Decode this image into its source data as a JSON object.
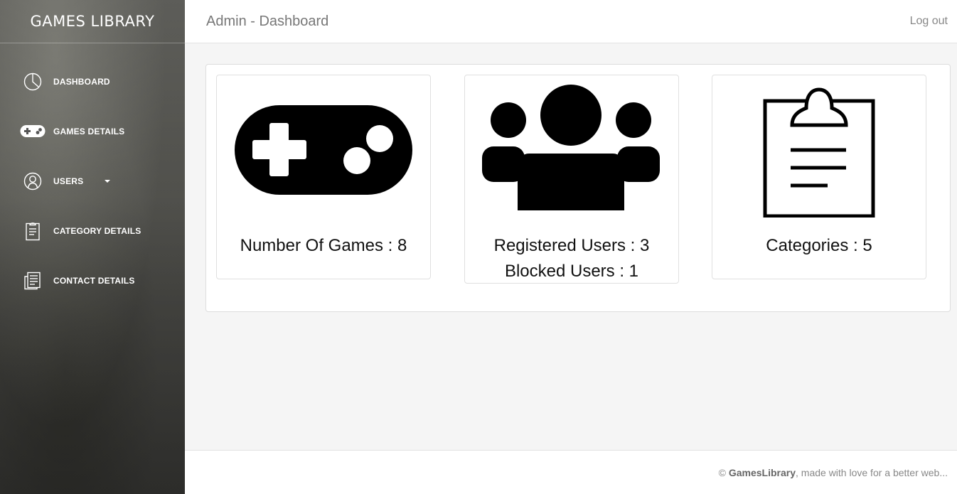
{
  "sidebar": {
    "brand": "GAMES LIBRARY",
    "items": [
      {
        "label": "DASHBOARD",
        "icon": "pie-chart-icon"
      },
      {
        "label": "GAMES DETAILS",
        "icon": "gamepad-icon"
      },
      {
        "label": "USERS",
        "icon": "user-icon"
      },
      {
        "label": "CATEGORY DETAILS",
        "icon": "clipboard-icon"
      },
      {
        "label": "CONTACT DETAILS",
        "icon": "document-icon"
      }
    ]
  },
  "header": {
    "title": "Admin - Dashboard",
    "logout": "Log out"
  },
  "stats": {
    "games": "Number Of Games : 8",
    "registered_users": "Registered Users : 3",
    "blocked_users": "Blocked Users : 1",
    "categories": "Categories : 5"
  },
  "footer": {
    "copyright_symbol": "©",
    "brand": "GamesLibrary",
    "tagline": ", made with love for a better web..."
  },
  "colors": {
    "sidebar_bg": "#5a5a55",
    "header_bg": "#ffffff",
    "main_bg": "#f5f5f5",
    "icon_fill": "#000000"
  }
}
